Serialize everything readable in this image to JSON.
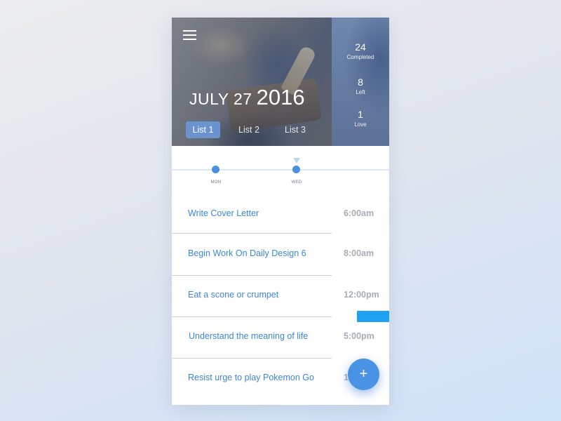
{
  "header": {
    "date_month_day": "JULY 27",
    "date_year": "2016",
    "tabs": [
      {
        "label": "List 1",
        "active": true
      },
      {
        "label": "List 2",
        "active": false
      },
      {
        "label": "List 3",
        "active": false
      }
    ]
  },
  "stats": [
    {
      "value": "24",
      "label": "Completed"
    },
    {
      "value": "8",
      "label": "Left"
    },
    {
      "value": "1",
      "label": "Love"
    }
  ],
  "timeline": {
    "days": [
      "MON",
      "WED"
    ],
    "selected_day": "WED"
  },
  "tasks": [
    {
      "title": "Write Cover Letter",
      "time": "6:00am"
    },
    {
      "title": "Begin Work On Daily Design 6",
      "time": "8:00am"
    },
    {
      "title": "Eat a scone or crumpet",
      "time": "12:00pm"
    },
    {
      "title": "Understand the meaning of life",
      "time": "5:00pm"
    },
    {
      "title": "Resist urge to play Pokemon Go",
      "time": "1"
    }
  ],
  "fab": {
    "label": "+"
  },
  "icons": {
    "menu": "hamburger-menu-icon",
    "add": "plus-icon"
  },
  "colors": {
    "accent": "#3d86d9",
    "fab": "#4a93e4",
    "active_tab": "#6b93cf",
    "accent_bar": "#1da1f0",
    "time_text": "#a9adb5"
  }
}
